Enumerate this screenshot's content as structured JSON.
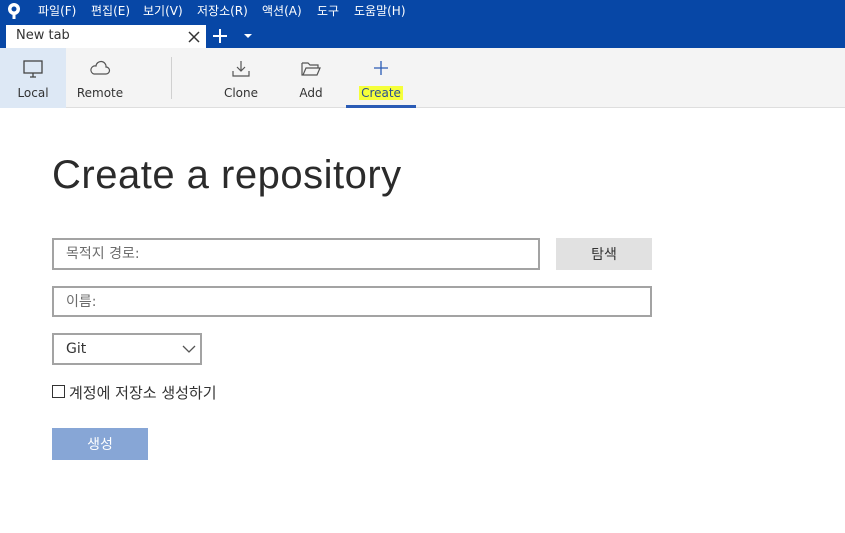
{
  "menu": {
    "items": [
      "파일(F)",
      "편집(E)",
      "보기(V)",
      "저장소(R)",
      "액션(A)",
      "도구",
      "도움말(H)"
    ]
  },
  "tabs": {
    "active_label": "New tab"
  },
  "toolbar": {
    "local_label": "Local",
    "remote_label": "Remote",
    "clone_label": "Clone",
    "add_label": "Add",
    "create_label": "Create"
  },
  "main": {
    "title": "Create a repository",
    "path_placeholder": "목적지 경로:",
    "browse_label": "탐색",
    "name_placeholder": "이름:",
    "vcs_selected": "Git",
    "account_checkbox_label": "계정에 저장소 생성하기",
    "account_checkbox_checked": false,
    "create_button_label": "생성"
  },
  "colors": {
    "titlebar": "#0747a6",
    "selected_tool": "#dde8f5",
    "create_highlight": "#f5ff3a",
    "create_button": "#87a6d6"
  }
}
